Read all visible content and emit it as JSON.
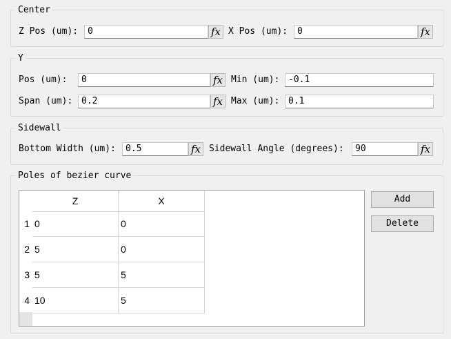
{
  "center": {
    "title": "Center",
    "zpos_label": "Z Pos (um):",
    "zpos_value": "0",
    "xpos_label": "X Pos (um):",
    "xpos_value": "0"
  },
  "y": {
    "title": "Y",
    "pos_label": "Pos (um):",
    "pos_value": "0",
    "min_label": "Min (um):",
    "min_value": "-0.1",
    "span_label": "Span (um):",
    "span_value": "0.2",
    "max_label": "Max (um):",
    "max_value": "0.1"
  },
  "sidewall": {
    "title": "Sidewall",
    "bottom_width_label": "Bottom Width (um):",
    "bottom_width_value": "0.5",
    "angle_label": "Sidewall Angle (degrees):",
    "angle_value": "90"
  },
  "fx_glyph": "fx",
  "poles": {
    "title": "Poles of bezier curve",
    "add_label": "Add",
    "delete_label": "Delete",
    "columns": [
      "Z",
      "X"
    ],
    "rows": [
      {
        "index": "1",
        "z": "0",
        "x": "0"
      },
      {
        "index": "2",
        "z": "5",
        "x": "0"
      },
      {
        "index": "3",
        "z": "5",
        "x": "5"
      },
      {
        "index": "4",
        "z": "10",
        "x": "5"
      }
    ]
  }
}
